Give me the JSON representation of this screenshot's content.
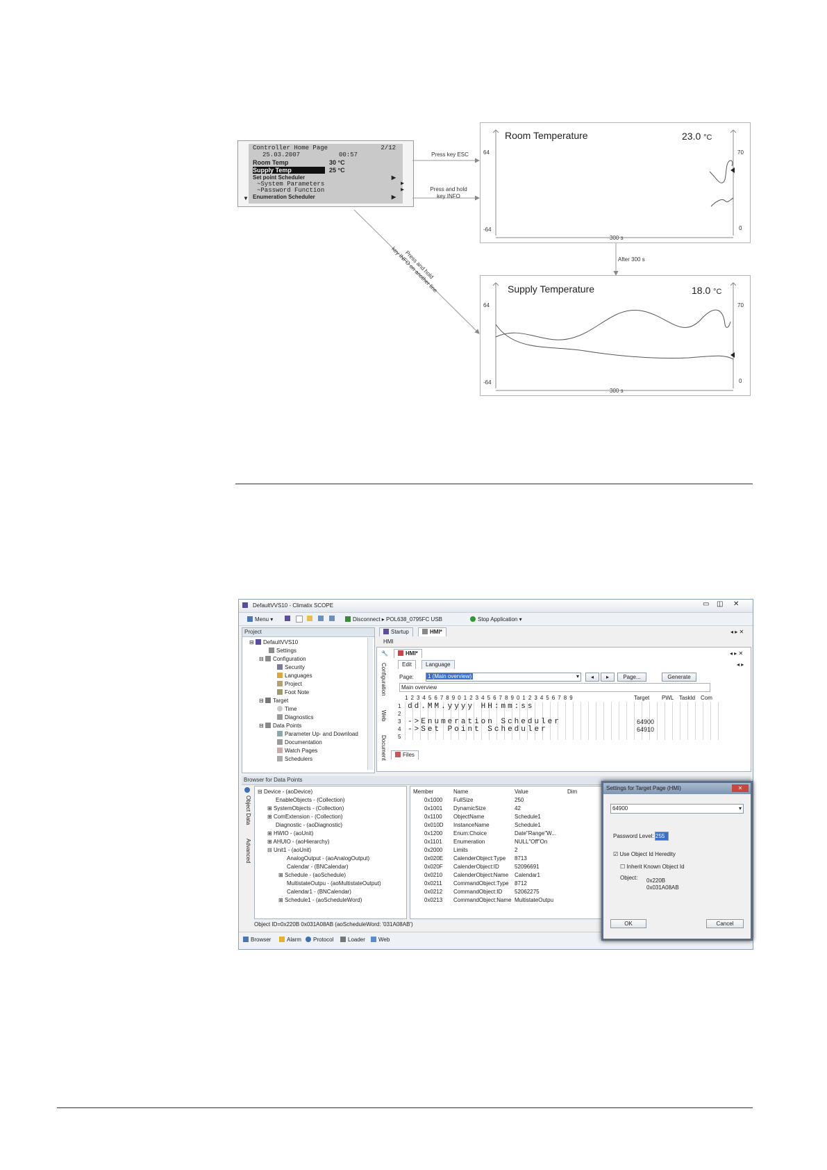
{
  "lcd": {
    "title": "Controller Home Page",
    "page": "2/12",
    "date": "25.03.2007",
    "time": "00:57",
    "rows": [
      {
        "label": "Room Temp",
        "value": "30 °C"
      },
      {
        "label": "Supply Temp",
        "value": "25 °C"
      }
    ],
    "menu": [
      "Set point Scheduler",
      "~System Parameters",
      "~Password Function",
      "Enumeration Scheduler"
    ]
  },
  "arrows": {
    "esc": "Press key ESC",
    "hold_info": [
      "Press and hold",
      "key INFO"
    ],
    "other_line": [
      "Press and hold",
      "key INFO on another line"
    ],
    "after": "After 300 s"
  },
  "graph_room": {
    "title": "Room Temperature",
    "value": "23.0",
    "unit": "°C",
    "left_top": "64",
    "left_bottom": "-64",
    "right_top": "70",
    "right_bottom": "0",
    "xspan": "300 s"
  },
  "graph_supply": {
    "title": "Supply Temperature",
    "value": "18.0",
    "unit": "°C",
    "left_top": "64",
    "left_bottom": "-64",
    "right_top": "70",
    "right_bottom": "0",
    "xspan": "300 s"
  },
  "window": {
    "title": "DefaultVVS10 - Climatix SCOPE",
    "toolbar": {
      "menu": "Menu",
      "disconnect": "Disconnect",
      "device": "POL638_0795FC",
      "usb": "USB",
      "stop": "Stop Application"
    },
    "project_head": "Project",
    "tree": [
      "DefaultVVS10",
      "Settings",
      "Configuration",
      "Security",
      "Languages",
      "Project",
      "Foot Note",
      "Target",
      "Time",
      "Diagnostics",
      "Data Points",
      "Parameter Up- and Download",
      "Documentation",
      "Watch Pages",
      "Schedulers"
    ],
    "tabs": [
      "Startup",
      "HMI*"
    ],
    "hmi_label": "HMI",
    "hmi_tab": "HMI*",
    "side_tabs": [
      "Configuration",
      "Web",
      "Document"
    ],
    "edit_tabs": [
      "Edit",
      "Language"
    ],
    "page_label": "Page:",
    "page_value": "1 (Main overview)",
    "page_btn": "Page...",
    "generate_btn": "Generate",
    "main_overview": "Main overview",
    "col_numbers": "1 2 3 4 5 6 7 8 9 0 1 2 3 4 5 6 7 8 9 0 1 2 3 4 5 6 7 8 9",
    "grid_headers": [
      "Target",
      "PWL",
      "TaskId",
      "Com"
    ],
    "grid_rows": [
      {
        "n": "1",
        "text": "dd.MM.yyyy  HH:mm:ss",
        "target": ""
      },
      {
        "n": "2",
        "text": "",
        "target": ""
      },
      {
        "n": "3",
        "text": "->Enumeration Scheduler",
        "target": "64900"
      },
      {
        "n": "4",
        "text": "->Set Point Scheduler",
        "target": "64910"
      },
      {
        "n": "5",
        "text": "",
        "target": ""
      }
    ],
    "files_tab": "Files",
    "browser_head": "Browser for Data Points",
    "browser_side": [
      "Object Data",
      "Advanced"
    ],
    "device_tree": [
      "Device - (aoDevice)",
      "EnableObjects - (Collection)",
      "SystemObjects - (Collection)",
      "ComExtension - (Collection)",
      "Diagnostic - (aoDiagnostic)",
      "HWIO - (aoUnit)",
      "AHUIO - (aoHierarchy)",
      "Unit1 - (aoUnit)",
      "AnalogOutput - (aoAnalogOutput)",
      "Calendar - (BNCalendar)",
      "Schedule - (aoSchedule)",
      "MultistateOutpu - (aoMultistateOutput)",
      "Calendar1 - (BNCalendar)",
      "Schedule1 - (aoScheduleWord)"
    ],
    "member_headers": [
      "Member",
      "Name",
      "Value",
      "Dim"
    ],
    "members": [
      [
        "0x1000",
        "FullSize",
        "250"
      ],
      [
        "0x1001",
        "DynamicSize",
        "42"
      ],
      [
        "0x1100",
        "ObjectName",
        "Schedule1"
      ],
      [
        "0x010D",
        "InstanceName",
        "Schedule1"
      ],
      [
        "0x1200",
        "Enum:Choice",
        "Date\"Range\"W..."
      ],
      [
        "0x1101",
        "Enumeration",
        "NULL\"Off\"On"
      ],
      [
        "0x2000",
        "Limits",
        "2"
      ],
      [
        "0x020E",
        "CalenderObject:Type",
        "8713"
      ],
      [
        "0x020F",
        "CalenderObject:ID",
        "52096691"
      ],
      [
        "0x0210",
        "CalenderObject:Name",
        "Calendar1"
      ],
      [
        "0x0211",
        "CommandObject:Type",
        "8712"
      ],
      [
        "0x0212",
        "CommandObject:ID",
        "52062275"
      ],
      [
        "0x0213",
        "CommandObject:Name",
        "MultistateOutpu"
      ]
    ],
    "object_id": "Object ID=0x220B 0x031A08AB (aoScheduleWord: '031A08AB')",
    "bottom_tabs": [
      "Browser",
      "Alarm",
      "Protocol",
      "Loader",
      "Web"
    ]
  },
  "dialog": {
    "title": "Settings for Target Page (HMI)",
    "combo": "64900",
    "password_label": "Password Level:",
    "password_value": "255",
    "use_object": "Use Object Id Heredity",
    "inherit": "Inherit Known Object Id",
    "object_label": "Object:",
    "object_values": [
      "0x220B",
      "0x031A08AB"
    ],
    "ok": "OK",
    "cancel": "Cancel"
  }
}
